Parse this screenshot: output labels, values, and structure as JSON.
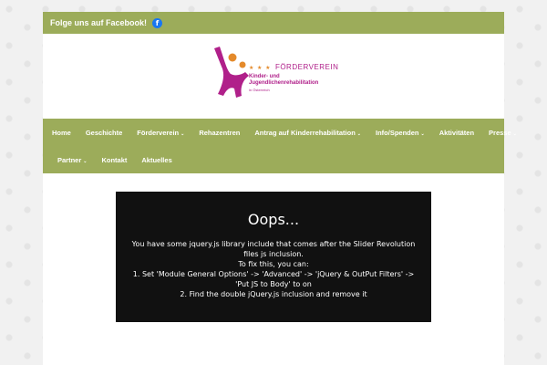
{
  "topbar": {
    "facebook_text": "Folge uns auf Facebook!",
    "icon": "facebook-icon"
  },
  "logo": {
    "stars": "★ ★ ★",
    "title": "FÖRDERVEREIN",
    "line1": "Kinder- und",
    "line2": "Jugendlichenrehabilitation",
    "line3": "in Österreich"
  },
  "nav": {
    "row1": [
      "Home",
      "Geschichte",
      "Förderverein",
      "Rehazentren",
      "Antrag auf Kinderrehabilitation",
      "Info/Spenden",
      "Aktivitäten",
      "Presse"
    ],
    "row2": [
      "Partner",
      "Kontakt",
      "Aktuelles"
    ],
    "caret": "⌄"
  },
  "slider_error": {
    "title": "Oops...",
    "line1": "You have some jquery.js library include that comes after the Slider Revolution files js inclusion.",
    "line2": "To fix this, you can:",
    "line3": "1. Set 'Module General Options' -> 'Advanced' -> 'jQuery & OutPut Filters' -> 'Put JS to Body' to on",
    "line4": "2. Find the double jQuery.js inclusion and remove it"
  },
  "colors": {
    "green": "#9cac5a",
    "magenta": "#b0208a",
    "orange": "#e48a2b"
  }
}
